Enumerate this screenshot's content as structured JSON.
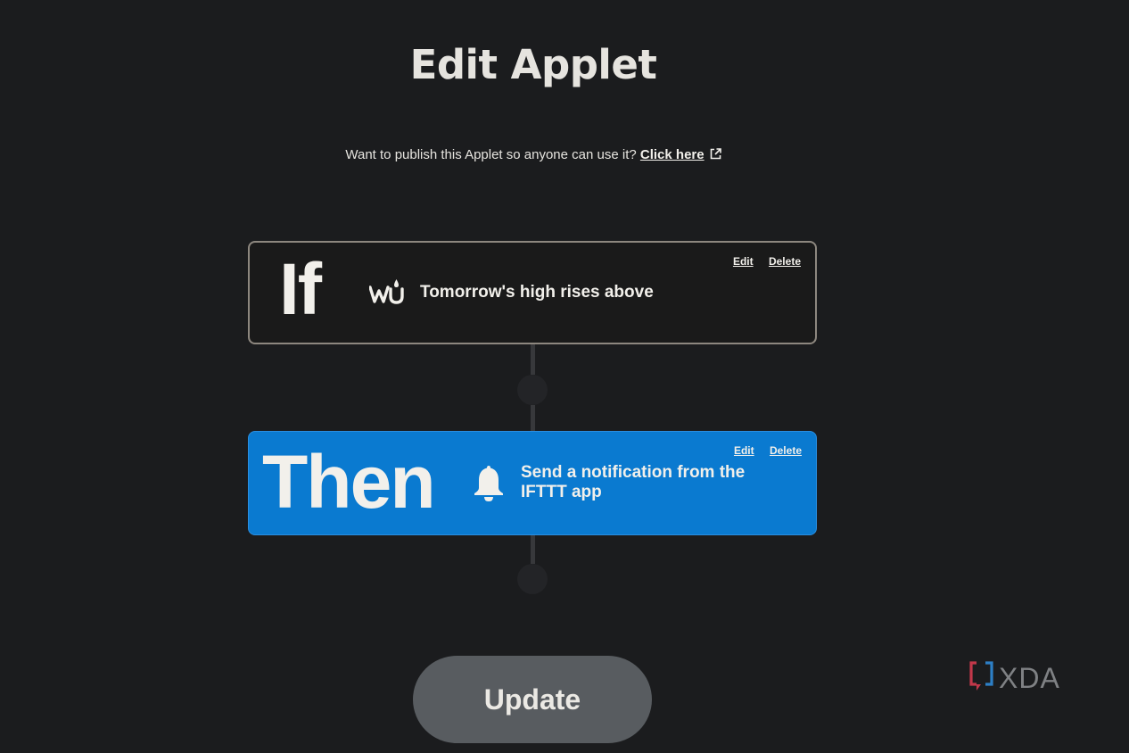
{
  "page": {
    "title": "Edit Applet",
    "publish_prompt": "Want to publish this Applet so anyone can use it?",
    "publish_link": "Click here"
  },
  "trigger": {
    "keyword": "If",
    "service_icon": "weather-underground-icon",
    "text": "Tomorrow's high rises above",
    "edit_label": "Edit",
    "delete_label": "Delete"
  },
  "action": {
    "keyword": "Then",
    "service_icon": "bell-icon",
    "text": "Send a notification from the IFTTT app",
    "edit_label": "Edit",
    "delete_label": "Delete",
    "color": "#0a7ad0"
  },
  "update_button": {
    "label": "Update"
  },
  "watermark": {
    "text": "XDA"
  }
}
